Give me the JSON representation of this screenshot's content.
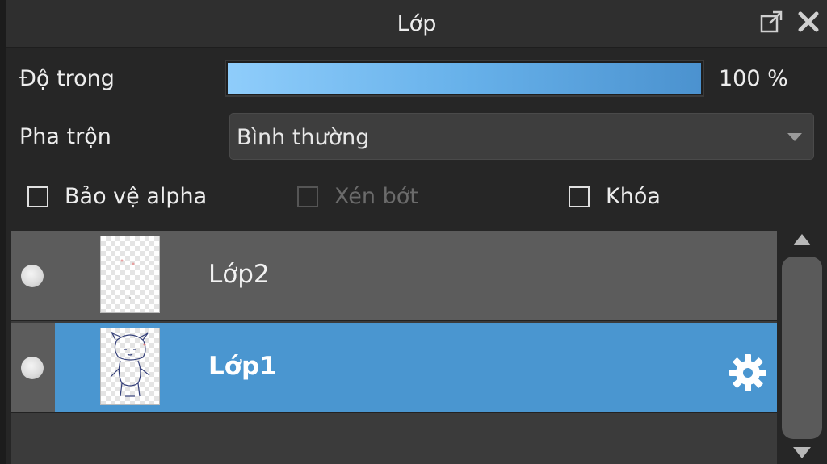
{
  "window": {
    "title": "Lớp",
    "float_icon": "popout-icon",
    "close_icon": "close-icon"
  },
  "opacity": {
    "label": "Độ trong",
    "value_text": "100 %",
    "value_fraction": 1.0
  },
  "blend": {
    "label": "Pha trộn",
    "selected": "Bình thường"
  },
  "options": {
    "protect_alpha": {
      "label": "Bảo vệ alpha",
      "checked": false,
      "enabled": true
    },
    "clipping": {
      "label": "Xén bớt",
      "checked": false,
      "enabled": false
    },
    "lock": {
      "label": "Khóa",
      "checked": false,
      "enabled": true
    }
  },
  "layers": [
    {
      "name": "Lớp2",
      "visible": true,
      "selected": false
    },
    {
      "name": "Lớp1",
      "visible": true,
      "selected": true,
      "settings_icon": "gear-icon"
    }
  ],
  "colors": {
    "selection": "#4a96d0",
    "opacity_bar_start": "#8fcdfb",
    "opacity_bar_end": "#4b92cf"
  }
}
